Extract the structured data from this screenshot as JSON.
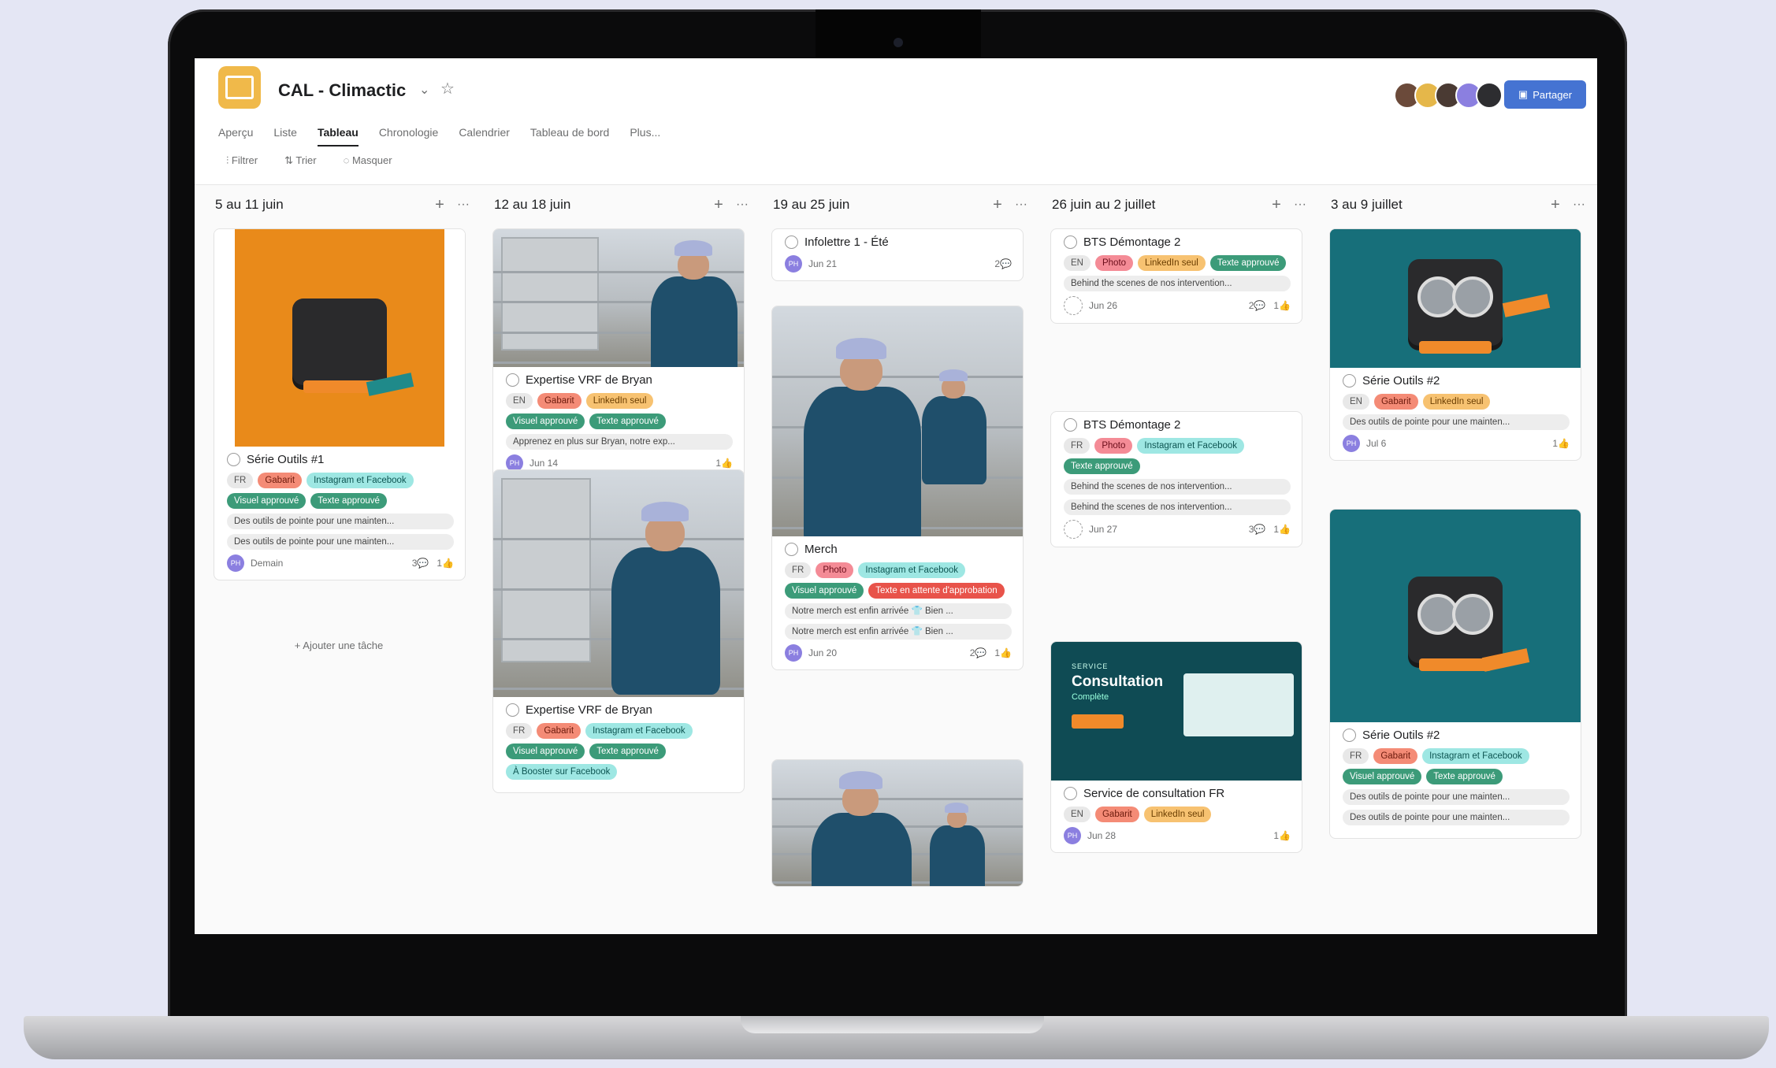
{
  "project": {
    "title": "CAL - Climactic",
    "title_chevron": "⌄",
    "star": "☆"
  },
  "tabs": [
    "Aperçu",
    "Liste",
    "Tableau",
    "Chronologie",
    "Calendrier",
    "Tableau de bord",
    "Plus..."
  ],
  "active_tab": "Tableau",
  "toolbar": {
    "filter": "Filtrer",
    "sort": "Trier",
    "hide": "Masquer"
  },
  "share_label": "Partager",
  "columns": [
    {
      "title": "5 au 11 juin",
      "cards": [
        {
          "title": "Série Outils #1",
          "tags": [
            {
              "text": "FR",
              "c": "gray"
            },
            {
              "text": "Gabarit",
              "c": "red"
            },
            {
              "text": "Instagram et Facebook",
              "c": "cyan"
            },
            {
              "text": "Visuel approuvé",
              "c": "green"
            },
            {
              "text": "Texte approuvé",
              "c": "green"
            }
          ],
          "lines": [
            "Des outils de pointe pour une mainten...",
            "Des outils de pointe pour une mainten..."
          ],
          "avatar": "PH",
          "date": "Demain",
          "comments": "3",
          "likes": "1"
        }
      ],
      "add_task": "+ Ajouter une tâche"
    },
    {
      "title": "12 au 18 juin",
      "cards": [
        {
          "title": "Expertise VRF de Bryan",
          "tags": [
            {
              "text": "EN",
              "c": "gray"
            },
            {
              "text": "Gabarit",
              "c": "red"
            },
            {
              "text": "LinkedIn seul",
              "c": "orange"
            },
            {
              "text": "Visuel approuvé",
              "c": "green"
            },
            {
              "text": "Texte approuvé",
              "c": "green"
            }
          ],
          "lines": [
            "Apprenez en plus sur Bryan, notre exp..."
          ],
          "avatar": "PH",
          "date": "Jun 14",
          "comments": "",
          "likes": "1"
        },
        {
          "title": "Expertise VRF de Bryan",
          "tags": [
            {
              "text": "FR",
              "c": "gray"
            },
            {
              "text": "Gabarit",
              "c": "red"
            },
            {
              "text": "Instagram et Facebook",
              "c": "cyan"
            },
            {
              "text": "Visuel approuvé",
              "c": "green"
            },
            {
              "text": "Texte approuvé",
              "c": "green"
            },
            {
              "text": "À Booster sur Facebook",
              "c": "cyan"
            }
          ],
          "lines": []
        }
      ]
    },
    {
      "title": "19 au 25 juin",
      "cards": [
        {
          "title": "Infolettre 1 - Été",
          "tags": [],
          "lines": [],
          "avatar": "PH",
          "date": "Jun 21",
          "comments": "2",
          "likes": ""
        },
        {
          "title": "Merch",
          "tags": [
            {
              "text": "FR",
              "c": "gray"
            },
            {
              "text": "Photo",
              "c": "pink"
            },
            {
              "text": "Instagram et Facebook",
              "c": "cyan"
            },
            {
              "text": "Visuel approuvé",
              "c": "green"
            },
            {
              "text": "Texte en attente d'approbation",
              "c": "redstrong"
            }
          ],
          "lines": [
            "Notre merch est enfin arrivée 👕 Bien ...",
            "Notre merch est enfin arrivée 👕 Bien ..."
          ],
          "avatar": "PH",
          "date": "Jun 20",
          "comments": "2",
          "likes": "1"
        },
        {
          "title": "",
          "tags": [],
          "lines": []
        }
      ]
    },
    {
      "title": "26 juin au 2 juillet",
      "cards": [
        {
          "title": "BTS Démontage 2",
          "tags": [
            {
              "text": "EN",
              "c": "gray"
            },
            {
              "text": "Photo",
              "c": "pink"
            },
            {
              "text": "LinkedIn seul",
              "c": "orange"
            },
            {
              "text": "Texte approuvé",
              "c": "green"
            }
          ],
          "lines": [
            "Behind the scenes de nos intervention..."
          ],
          "avatar": "",
          "date": "Jun 26",
          "comments": "2",
          "likes": "1"
        },
        {
          "title": "BTS Démontage 2",
          "tags": [
            {
              "text": "FR",
              "c": "gray"
            },
            {
              "text": "Photo",
              "c": "pink"
            },
            {
              "text": "Instagram et Facebook",
              "c": "cyan"
            },
            {
              "text": "Texte approuvé",
              "c": "green"
            }
          ],
          "lines": [
            "Behind the scenes de nos intervention...",
            "Behind the scenes de nos intervention..."
          ],
          "avatar": "",
          "date": "Jun 27",
          "comments": "3",
          "likes": "1"
        },
        {
          "title": "Service de consultation FR",
          "tags": [
            {
              "text": "EN",
              "c": "gray"
            },
            {
              "text": "Gabarit",
              "c": "red"
            },
            {
              "text": "LinkedIn seul",
              "c": "orange"
            }
          ],
          "lines": [],
          "avatar": "PH",
          "date": "Jun 28",
          "comments": "",
          "likes": "1",
          "banner_small": "SERVICE",
          "banner_big": "Consultation",
          "banner_sub": "Complète"
        }
      ]
    },
    {
      "title": "3 au 9 juillet",
      "cards": [
        {
          "title": "Série Outils #2",
          "tags": [
            {
              "text": "EN",
              "c": "gray"
            },
            {
              "text": "Gabarit",
              "c": "red"
            },
            {
              "text": "LinkedIn seul",
              "c": "orange"
            }
          ],
          "lines": [
            "Des outils de pointe pour une mainten..."
          ],
          "avatar": "PH",
          "date": "Jul 6",
          "comments": "",
          "likes": "1"
        },
        {
          "title": "Série Outils #2",
          "tags": [
            {
              "text": "FR",
              "c": "gray"
            },
            {
              "text": "Gabarit",
              "c": "red"
            },
            {
              "text": "Instagram et Facebook",
              "c": "cyan"
            },
            {
              "text": "Visuel approuvé",
              "c": "green"
            },
            {
              "text": "Texte approuvé",
              "c": "green"
            }
          ],
          "lines": [
            "Des outils de pointe pour une mainten...",
            "Des outils de pointe pour une mainten..."
          ]
        }
      ]
    }
  ],
  "colors": {
    "accent": "#4573d2",
    "orange_post": "#e98a1a",
    "teal_post": "#176f7a",
    "dark_teal_banner": "#0f4b54"
  },
  "icons": {
    "check": "check-circle-icon",
    "plus": "plus-icon",
    "more": "more-icon",
    "comment": "comment-icon",
    "like": "thumbs-up-icon"
  }
}
